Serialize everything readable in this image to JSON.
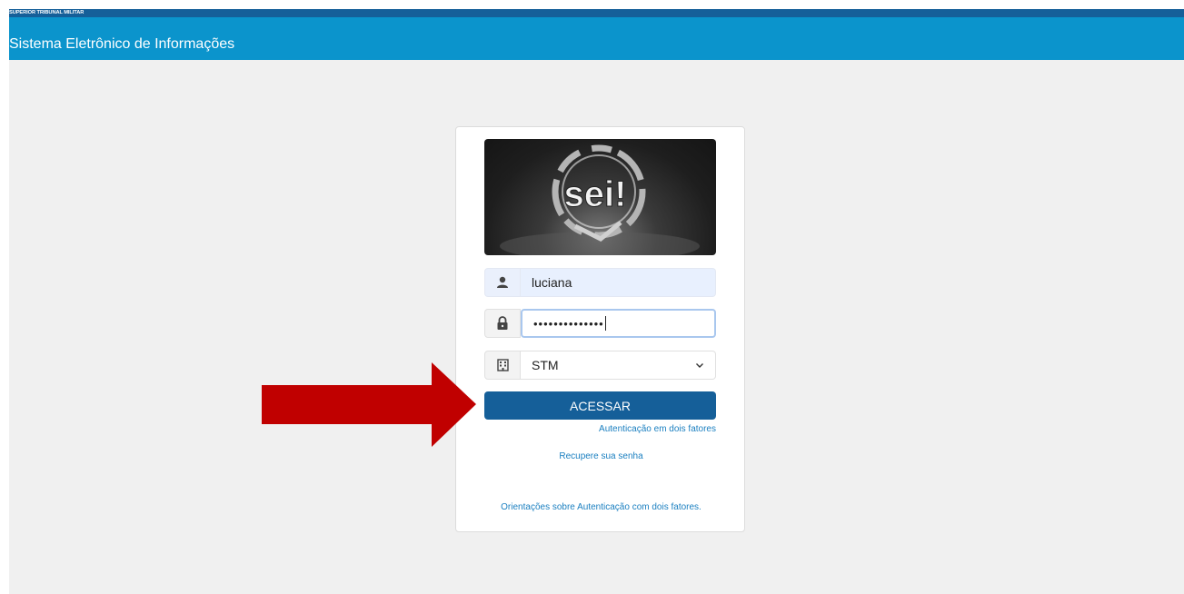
{
  "header": {
    "org_name": "SUPERIOR TRIBUNAL MILITAR",
    "app_title": "Sistema Eletrônico de Informações"
  },
  "login": {
    "logo_text": "sei!",
    "username_value": "luciana",
    "password_mask": "••••••••••••••",
    "organization_selected": "STM",
    "submit_label": "ACESSAR",
    "two_factor_link": "Autenticação em dois fatores",
    "recover_link": "Recupere sua senha",
    "guidance_link": "Orientações sobre Autenticação com dois fatores."
  },
  "icons": {
    "user": "user-icon",
    "lock": "lock-icon",
    "building": "building-icon",
    "chevron": "chevron-down-icon",
    "annotation": "arrow-right-icon"
  },
  "colors": {
    "header_dark": "#155f99",
    "header_light": "#0b94cc",
    "button": "#155f99",
    "link": "#1a7fc0",
    "arrow": "#c00000"
  }
}
